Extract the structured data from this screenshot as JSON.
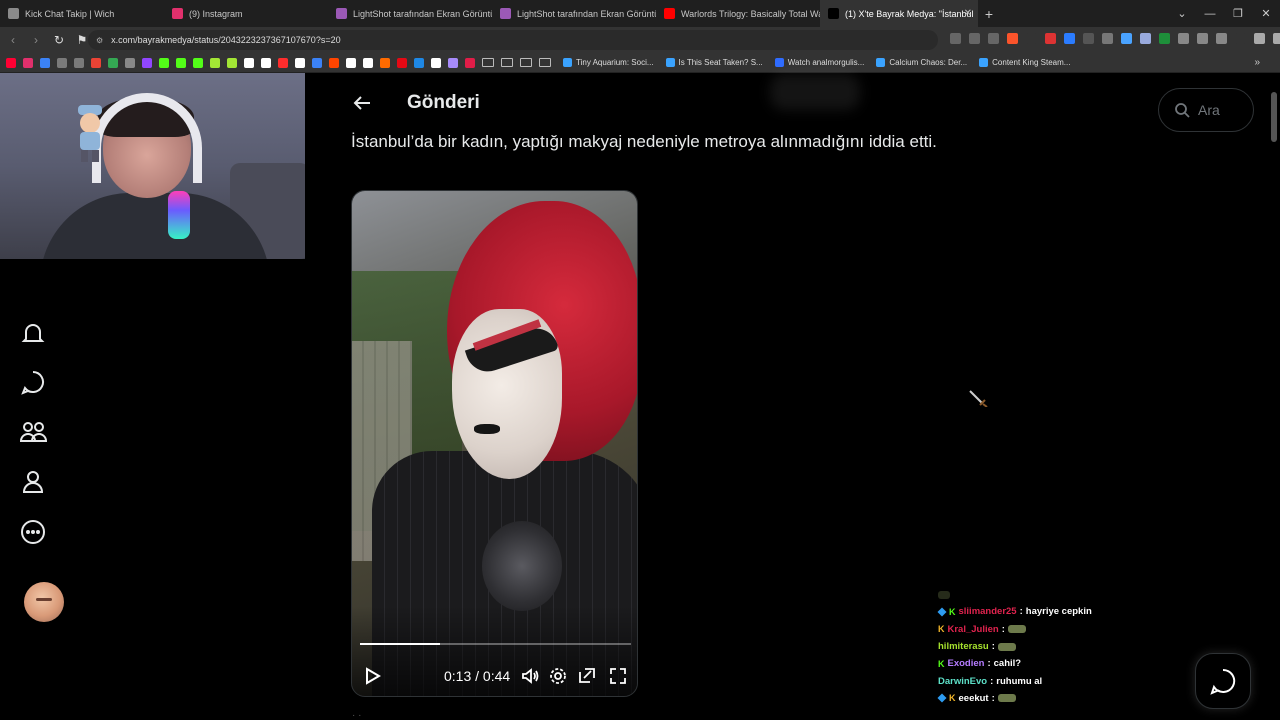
{
  "browser": {
    "tabs": [
      {
        "label": "Kick Chat Takip | Wich",
        "fav_color": "#8a8a8a"
      },
      {
        "label": "(9) Instagram",
        "fav_color": "#e1306c"
      },
      {
        "label": "LightShot tarafından Ekran Görüntüsü",
        "fav_color": "#9b59b6"
      },
      {
        "label": "LightShot tarafından Ekran Görüntüsü",
        "fav_color": "#9b59b6"
      },
      {
        "label": "Warlords Trilogy: Basically Total War",
        "fav_color": "#ff0000"
      },
      {
        "label": "(1) X'te Bayrak Medya: \"İstanbul",
        "fav_color": "#000000",
        "active": true
      }
    ],
    "new_tab": "+",
    "url": "x.com/bayrakmedya/status/2043223237367107670?s=20",
    "bookmarks": [
      {
        "label": "Tiny Aquarium: Soci...",
        "color": "#3aa3ff"
      },
      {
        "label": "Is This Seat Taken? S...",
        "color": "#3aa3ff"
      },
      {
        "label": "Watch analmorgulis...",
        "color": "#2f6cff"
      },
      {
        "label": "Calcium Chaos: Der...",
        "color": "#3aa3ff"
      },
      {
        "label": "Content King Steam...",
        "color": "#3aa3ff"
      }
    ],
    "bookmark_icon_colors": [
      "#ff0033",
      "#e1306c",
      "#3b82f6",
      "#7a7a7a",
      "#7a7a7a",
      "#ea4335",
      "#34a853",
      "#888",
      "#9146ff",
      "#53fc18",
      "#53fc18",
      "#53fc18",
      "#a3e635",
      "#a3e635",
      "#ffffff",
      "#ffffff",
      "#ff2d2d",
      "#ffffff",
      "#3b82f6",
      "#ff4500",
      "#ffffff",
      "#ffffff",
      "#ff6b00",
      "#e50914",
      "#1e88e5",
      "#ffffff",
      "#a78bfa",
      "#e11d48"
    ]
  },
  "post": {
    "title": "Gönderi",
    "text": "İstanbul’da bir kadın, yaptığı makyaj nedeniyle metroya alınmadığını iddia etti.",
    "video": {
      "time": "0:13 / 0:44",
      "progress": 0.295
    }
  },
  "search": {
    "placeholder": "Ara"
  },
  "chat": [
    {
      "user": "sliimander25",
      "message": "hayriye cepkin",
      "user_color": "#e0234e",
      "badges": [
        "cube",
        "k-green"
      ],
      "emote": false
    },
    {
      "user": "Kral_Julien",
      "message": "",
      "user_color": "#e0234e",
      "badges": [
        "k-gold"
      ],
      "emote": true
    },
    {
      "user": "hilmiterasu",
      "message": "",
      "user_color": "#a6e22e",
      "badges": [],
      "emote": true
    },
    {
      "user": "Exodien",
      "message": "cahil?",
      "user_color": "#b57cff",
      "badges": [
        "k-green"
      ],
      "emote": false
    },
    {
      "user": "DarwinEvo",
      "message": "ruhumu al",
      "user_color": "#5de0c8",
      "badges": [],
      "emote": false
    },
    {
      "user": "eeekut",
      "message": "",
      "user_color": "#ffffff",
      "badges": [
        "cube",
        "k-gold"
      ],
      "emote": true
    }
  ]
}
